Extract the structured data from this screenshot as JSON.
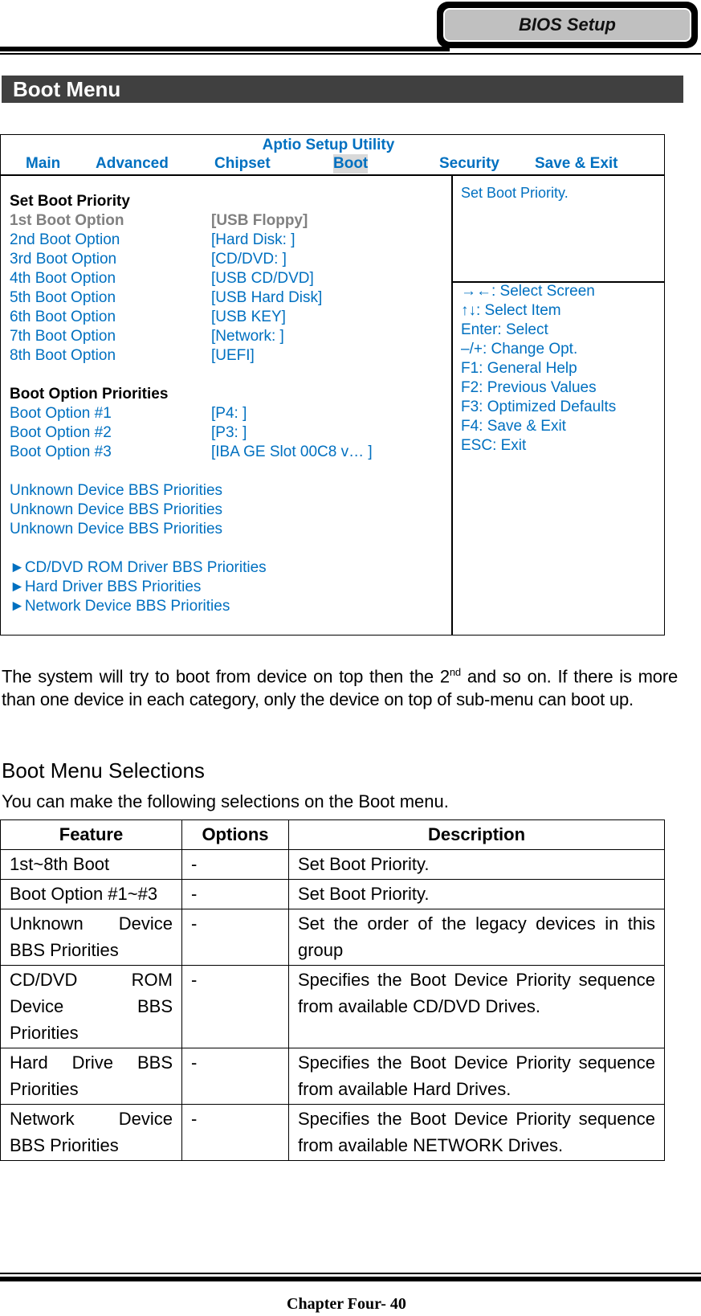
{
  "header": {
    "tab_label": "BIOS Setup"
  },
  "section_title": "Boot Menu",
  "bios": {
    "utility_title": "Aptio Setup Utility",
    "tabs": [
      {
        "label": "Main",
        "active": false
      },
      {
        "label": "Advanced",
        "active": false
      },
      {
        "label": "Chipset",
        "active": false
      },
      {
        "label": "Boot",
        "active": true
      },
      {
        "label": "Security",
        "active": false
      },
      {
        "label": "Save & Exit",
        "active": false
      }
    ],
    "set_boot_priority_heading": "Set Boot Priority",
    "boot_options": [
      {
        "label": "1st Boot Option",
        "value": "[USB Floppy]",
        "selected": true
      },
      {
        "label": "2nd Boot Option",
        "value": "[Hard Disk: ]"
      },
      {
        "label": "3rd Boot Option",
        "value": "[CD/DVD: ]"
      },
      {
        "label": "4th Boot Option",
        "value": "[USB CD/DVD]"
      },
      {
        "label": "5th Boot Option",
        "value": "[USB Hard Disk]"
      },
      {
        "label": "6th Boot Option",
        "value": "[USB KEY]"
      },
      {
        "label": "7th Boot Option",
        "value": "[Network: ]"
      },
      {
        "label": "8th Boot Option",
        "value": "[UEFI]"
      }
    ],
    "priorities_heading": "Boot Option Priorities",
    "priority_options": [
      {
        "label": "Boot Option #1",
        "value": "[P4: ]"
      },
      {
        "label": "Boot Option #2",
        "value": "[P3: ]"
      },
      {
        "label": "Boot Option #3",
        "value": "[IBA GE Slot 00C8 v… ]"
      }
    ],
    "unknown_devices": [
      "Unknown Device BBS Priorities",
      "Unknown Device BBS Priorities",
      "Unknown Device BBS Priorities"
    ],
    "submenus": [
      {
        "arrow": "►",
        "label": "CD/DVD ROM Driver BBS Priorities"
      },
      {
        "arrow": "►",
        "label": "Hard Driver BBS Priorities"
      },
      {
        "arrow": "►",
        "label": "Network Device BBS Priorities"
      }
    ],
    "help_text": "Set Boot Priority.",
    "key_help": [
      "→←: Select Screen",
      "↑↓: Select Item",
      "Enter: Select",
      "–/+: Change Opt.",
      "F1: General Help",
      "F2: Previous Values",
      "F3: Optimized Defaults",
      "F4: Save & Exit",
      "ESC: Exit"
    ]
  },
  "paragraph": {
    "before_sup": "The system will try to boot from device on top then the 2",
    "sup": "nd",
    "after_sup": " and so on. If there is more than one device in each category, only the device on top of sub-menu can boot up."
  },
  "selections": {
    "heading": "Boot Menu Selections",
    "intro": "You can make the following selections on the Boot menu.",
    "columns": [
      "Feature",
      "Options",
      "Description"
    ],
    "rows": [
      {
        "feature": "1st~8th Boot",
        "options": "-",
        "description": "Set Boot Priority."
      },
      {
        "feature": "Boot Option #1~#3",
        "options": "-",
        "description": "Set Boot Priority."
      },
      {
        "feature": "Unknown Device BBS Priorities",
        "options": "-",
        "description": "Set the order of the legacy devices in this group"
      },
      {
        "feature": "CD/DVD ROM Device BBS Priorities",
        "options": "-",
        "description": "Specifies the Boot Device Priority sequence from available CD/DVD Drives."
      },
      {
        "feature": "Hard Drive BBS Priorities",
        "options": "-",
        "description": "Specifies the Boot Device Priority sequence from available Hard Drives."
      },
      {
        "feature": "Network Device BBS Priorities",
        "options": "-",
        "description": "Specifies the Boot Device Priority sequence from available NETWORK Drives."
      }
    ]
  },
  "footer": {
    "page_label": "Chapter Four- 40"
  }
}
